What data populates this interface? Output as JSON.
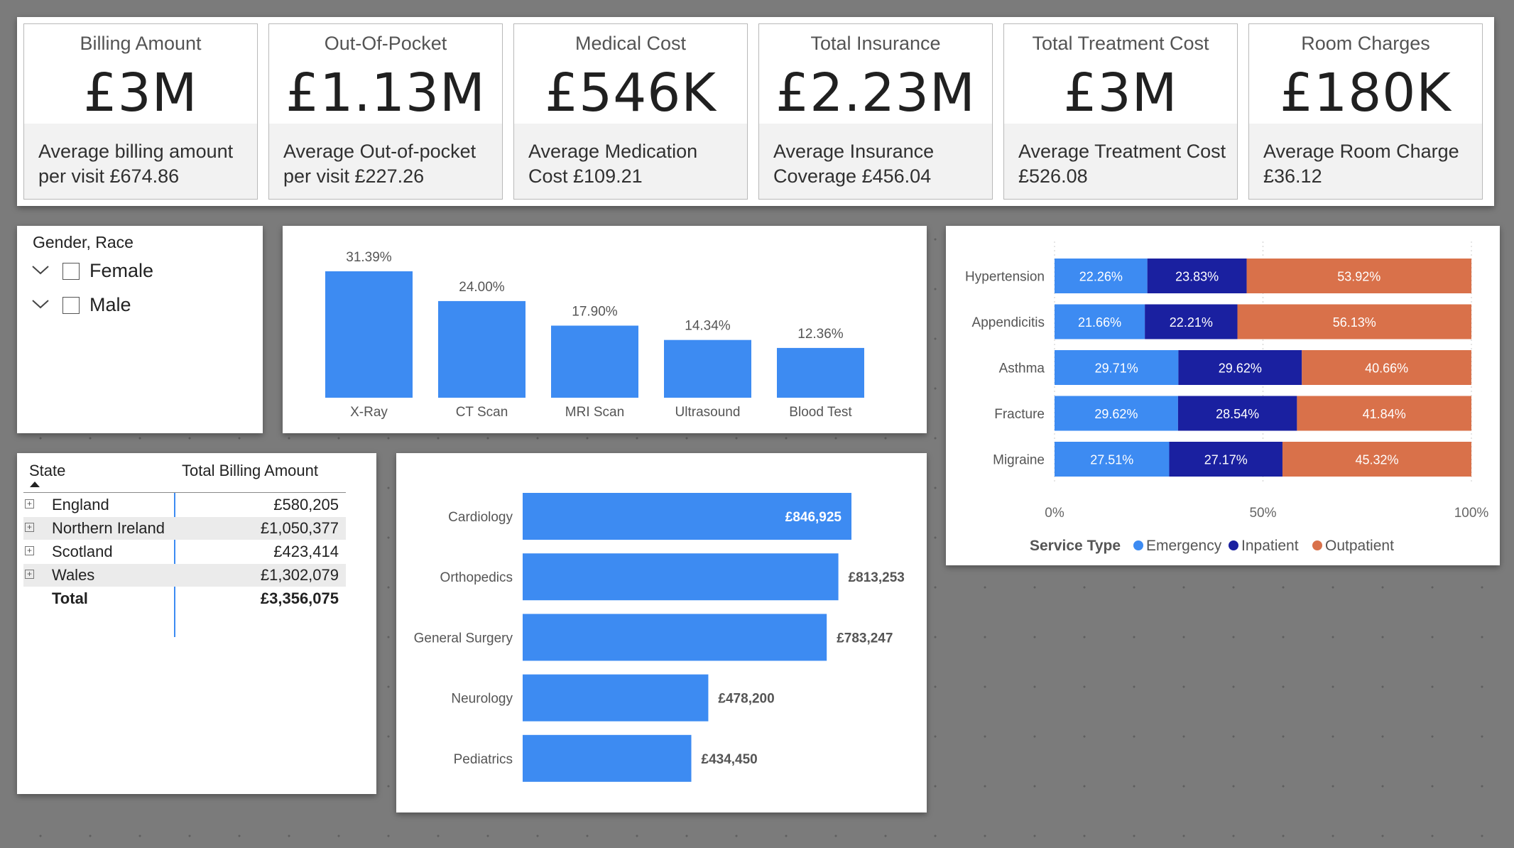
{
  "kpis": [
    {
      "title": "Billing Amount",
      "value": "£3M",
      "subtitle_line1": "Average billing amount",
      "subtitle_line2": "per visit £674.86"
    },
    {
      "title": "Out-Of-Pocket",
      "value": "£1.13M",
      "subtitle_line1": "Average Out-of-pocket",
      "subtitle_line2": "per visit £227.26"
    },
    {
      "title": "Medical Cost",
      "value": "£546K",
      "subtitle_line1": "Average Medication",
      "subtitle_line2": "Cost £109.21"
    },
    {
      "title": "Total Insurance",
      "value": "£2.23M",
      "subtitle_line1": "Average Insurance",
      "subtitle_line2": "Coverage £456.04"
    },
    {
      "title": "Total Treatment Cost",
      "value": "£3M",
      "subtitle_line1": "Average Treatment Cost",
      "subtitle_line2": "£526.08"
    },
    {
      "title": "Room Charges",
      "value": "£180K",
      "subtitle_line1": "Average Room Charge",
      "subtitle_line2": "£36.12"
    }
  ],
  "slicer": {
    "title": "Gender, Race",
    "items": [
      {
        "label": "Female",
        "checked": false
      },
      {
        "label": "Male",
        "checked": false
      }
    ]
  },
  "matrix": {
    "headers": {
      "state": "State",
      "amount": "Total Billing Amount"
    },
    "rows": [
      {
        "state": "England",
        "amount": "£580,205"
      },
      {
        "state": "Northern Ireland",
        "amount": "£1,050,377"
      },
      {
        "state": "Scotland",
        "amount": "£423,414"
      },
      {
        "state": "Wales",
        "amount": "£1,302,079"
      }
    ],
    "total": {
      "label": "Total",
      "amount": "£3,356,075"
    },
    "sort_indicator": "ascending"
  },
  "colors": {
    "bar_blue": "#3d8bf2",
    "emergency": "#3d8bf2",
    "inpatient": "#1a20a0",
    "outpatient": "#d9714a",
    "panel_bg": "#ffffff",
    "canvas_bg": "#7b7b7b"
  },
  "chart_data": [
    {
      "type": "bar",
      "orientation": "vertical",
      "categories": [
        "X-Ray",
        "CT Scan",
        "MRI Scan",
        "Ultrasound",
        "Blood Test"
      ],
      "values": [
        31.39,
        24.0,
        17.9,
        14.34,
        12.36
      ],
      "value_labels": [
        "31.39%",
        "24.00%",
        "17.90%",
        "14.34%",
        "12.36%"
      ],
      "title": "",
      "xlabel": "",
      "ylabel": "",
      "grid": false
    },
    {
      "type": "bar",
      "orientation": "horizontal",
      "categories": [
        "Cardiology",
        "Orthopedics",
        "General Surgery",
        "Neurology",
        "Pediatrics"
      ],
      "values": [
        846925,
        813253,
        783247,
        478200,
        434450
      ],
      "value_labels": [
        "£846,925",
        "£813,253",
        "£783,247",
        "£478,200",
        "£434,450"
      ],
      "title": "",
      "xlabel": "",
      "ylabel": "",
      "grid": false
    },
    {
      "type": "bar",
      "orientation": "horizontal",
      "stacked": "100%",
      "categories": [
        "Hypertension",
        "Appendicitis",
        "Asthma",
        "Fracture",
        "Migraine"
      ],
      "series": [
        {
          "name": "Emergency",
          "values": [
            22.26,
            21.66,
            29.71,
            29.62,
            27.51
          ],
          "labels": [
            "22.26%",
            "21.66%",
            "29.71%",
            "29.62%",
            "27.51%"
          ]
        },
        {
          "name": "Inpatient",
          "values": [
            23.83,
            22.21,
            29.62,
            28.54,
            27.17
          ],
          "labels": [
            "23.83%",
            "22.21%",
            "29.62%",
            "28.54%",
            "27.17%"
          ]
        },
        {
          "name": "Outpatient",
          "values": [
            53.92,
            56.13,
            40.66,
            41.84,
            45.32
          ],
          "labels": [
            "53.92%",
            "56.13%",
            "40.66%",
            "41.84%",
            "45.32%"
          ]
        }
      ],
      "xlim": [
        0,
        100
      ],
      "x_ticks": [
        "0%",
        "50%",
        "100%"
      ],
      "legend_title": "Service Type",
      "legend_position": "bottom",
      "grid": true
    }
  ]
}
